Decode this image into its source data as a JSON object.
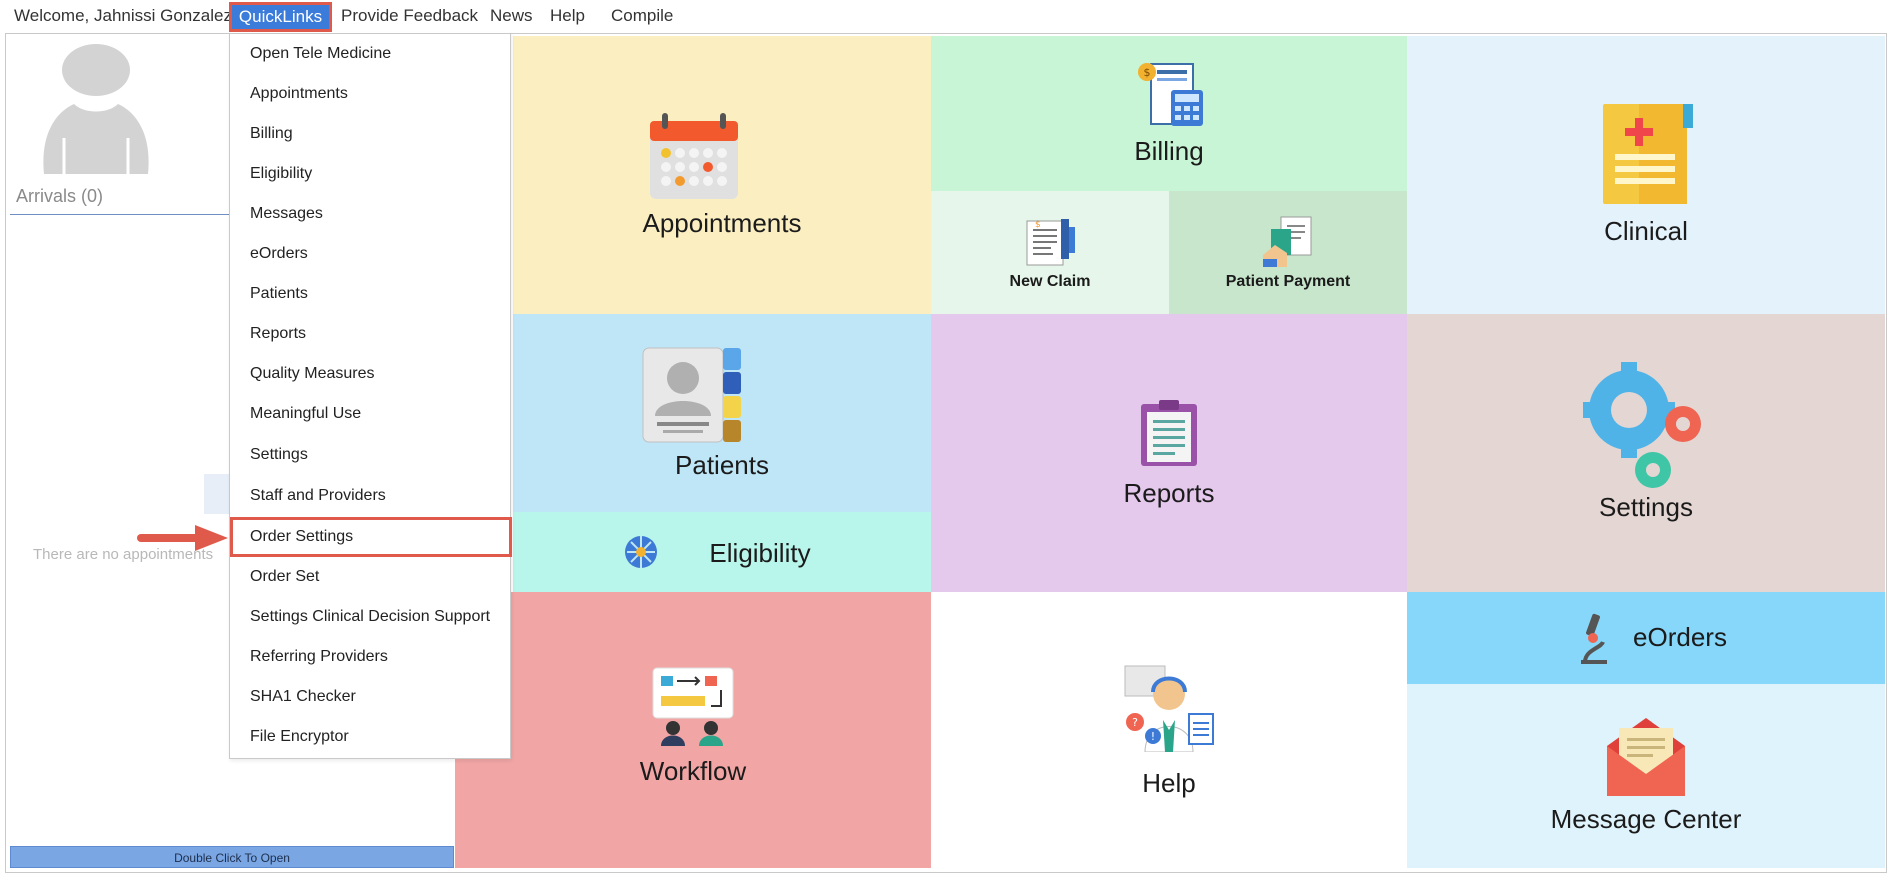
{
  "menubar": {
    "welcome": "Welcome, Jahnissi Gonzalez",
    "quicklinks": "QuickLinks",
    "feedback": "Provide Feedback",
    "news": "News",
    "help": "Help",
    "compile": "Compile"
  },
  "left_panel": {
    "arrivals": "Arrivals (0)",
    "no_appointments": "There are no appointments",
    "double_click": "Double Click To Open"
  },
  "quicklinks_menu": {
    "items": [
      "Open Tele Medicine",
      "Appointments",
      "Billing",
      "Eligibility",
      "Messages",
      "eOrders",
      "Patients",
      "Reports",
      "Quality Measures",
      "Meaningful Use",
      "Settings",
      "Staff and Providers",
      "Order Settings",
      "Order Set",
      "Settings Clinical Decision Support",
      "Referring Providers",
      "SHA1 Checker",
      "File Encryptor"
    ],
    "highlighted": "Order Settings"
  },
  "tiles": {
    "appointments": "Appointments",
    "billing": "Billing",
    "new_claim": "New Claim",
    "patient_payment": "Patient Payment",
    "clinical": "Clinical",
    "patients": "Patients",
    "eligibility": "Eligibility",
    "reports": "Reports",
    "settings": "Settings",
    "workflow": "Workflow",
    "help": "Help",
    "eorders": "eOrders",
    "message_center": "Message Center"
  },
  "colors": {
    "highlight_border": "#e05a4c",
    "quicklinks_bg": "#3b7bd9",
    "appointments": "#fbefc2",
    "billing": "#c8f5d6",
    "clinical": "#e3f2fb",
    "patients": "#bfe6f7",
    "eligibility": "#b8f5ea",
    "reports": "#e4c9ec",
    "settings": "#e3d6d3",
    "workflow": "#f1a6a5",
    "eorders": "#86d7f9",
    "message_center": "#dff3fc"
  }
}
